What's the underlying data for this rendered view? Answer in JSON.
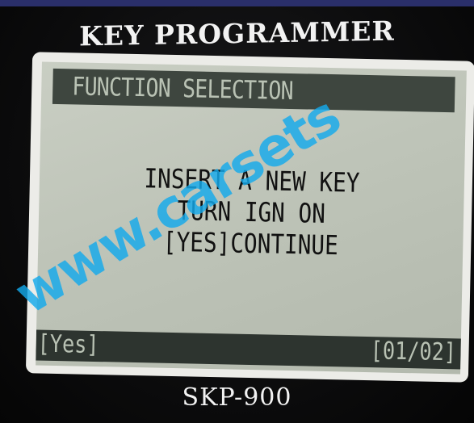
{
  "device": {
    "brand_title": "KEY PROGRAMMER",
    "model": "SKP-900"
  },
  "screen": {
    "header": "FUNCTION SELECTION",
    "lines": [
      "INSERT A NEW KEY",
      "TURN IGN ON",
      "[YES]CONTINUE"
    ],
    "footer_left": "[Yes]",
    "footer_right": "[01/02]"
  },
  "watermark": "www.carsets"
}
